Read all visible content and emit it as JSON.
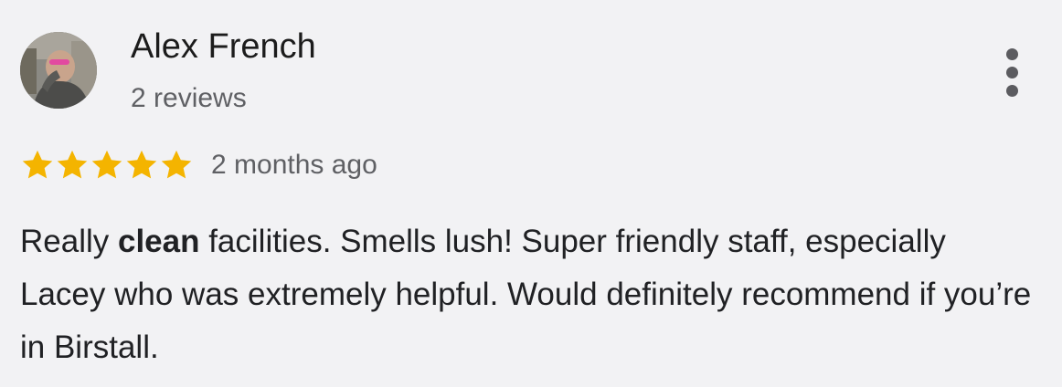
{
  "reviewer": {
    "name": "Alex French",
    "reviews_count": "2 reviews"
  },
  "rating": {
    "stars": 5,
    "max_stars": 5,
    "star_color": "#f4b400",
    "time_ago": "2 months ago"
  },
  "review": {
    "text_before": "Really ",
    "text_bold": "clean",
    "text_after": " facilities. Smells lush! Super friendly staff, especially Lacey who was extremely helpful. Would definitely recommend if you’re in Birstall."
  },
  "icons": {
    "more": "more-vertical-icon",
    "star": "star-icon"
  }
}
